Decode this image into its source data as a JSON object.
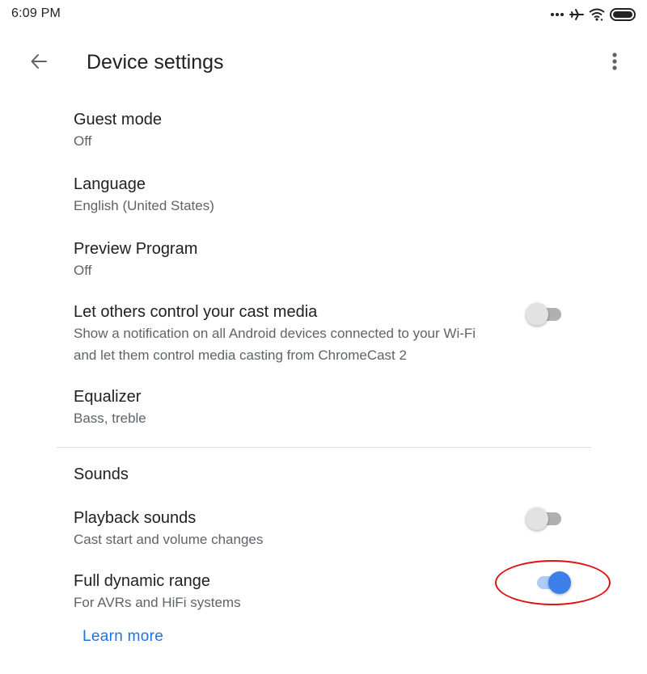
{
  "status_bar": {
    "time": "6:09 PM",
    "icons": [
      "more-notifications-icon",
      "airplane-mode-icon",
      "wifi-icon",
      "battery-icon"
    ]
  },
  "app_bar": {
    "title": "Device settings",
    "back_icon": "arrow-back-icon",
    "overflow_icon": "more-vert-icon"
  },
  "settings": [
    {
      "title": "Guest mode",
      "summary": "Off"
    },
    {
      "title": "Language",
      "summary": "English (United States)"
    },
    {
      "title": "Preview Program",
      "summary": "Off"
    },
    {
      "title": "Let others control your cast media",
      "summary_lines": [
        "Show a notification on all Android devices connected to your Wi-Fi",
        "and let them control media casting from ChromeCast 2"
      ],
      "toggle": false
    },
    {
      "title": "Equalizer",
      "summary": "Bass, treble"
    }
  ],
  "sounds_section": {
    "header": "Sounds",
    "items": [
      {
        "title": "Playback sounds",
        "summary": "Cast start and volume changes",
        "toggle": false
      },
      {
        "title": "Full dynamic range",
        "summary": "For AVRs and HiFi systems",
        "toggle": true
      }
    ],
    "learn_more": "Learn more"
  },
  "colors": {
    "accent": "#1a73e8",
    "toggle_on_thumb": "#3c7fe8",
    "toggle_on_track": "#aecbfa",
    "annotation": "#e01010"
  }
}
